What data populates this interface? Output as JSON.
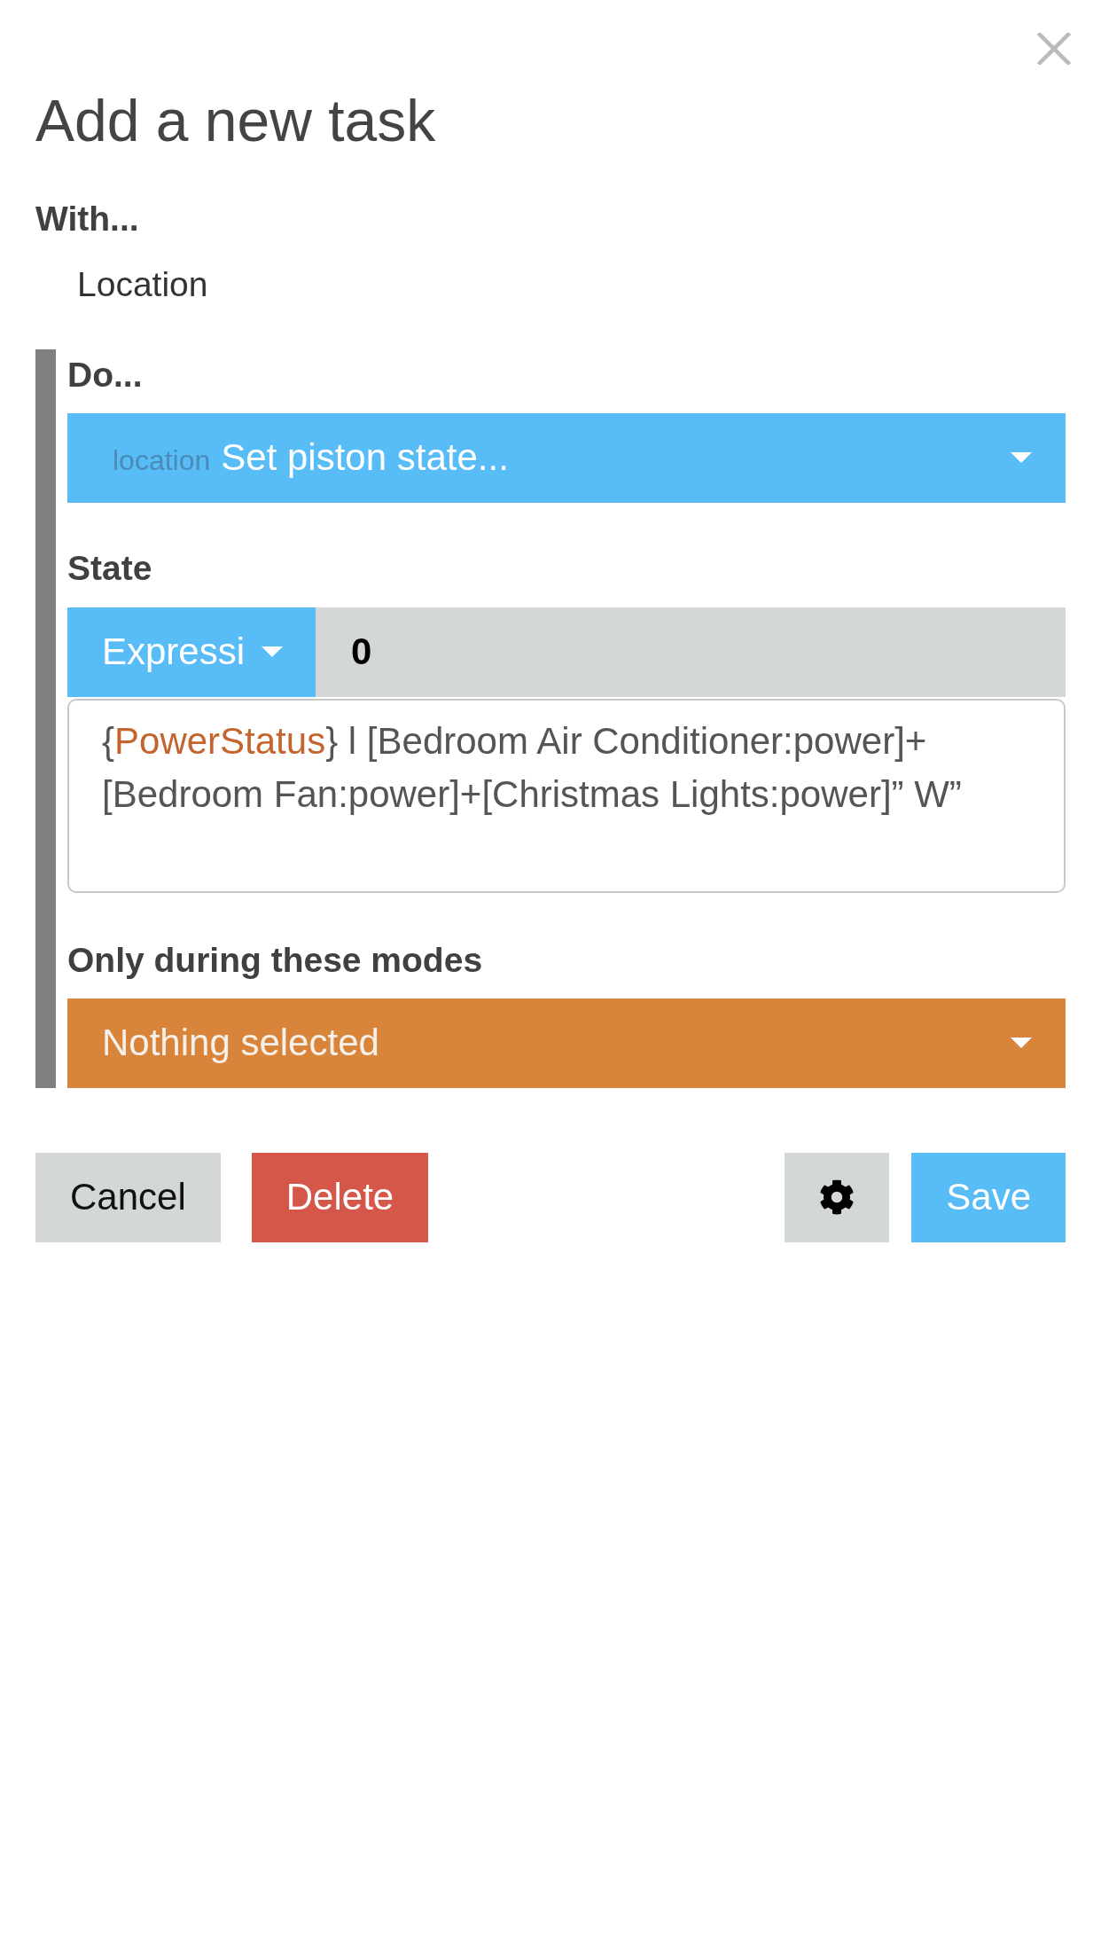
{
  "title": "Add a new task",
  "with": {
    "label": "With...",
    "value": "Location"
  },
  "do": {
    "label": "Do...",
    "context": "location",
    "value": "Set piston state..."
  },
  "state": {
    "label": "State",
    "type": "Expressi",
    "value": "0",
    "expression": [
      {
        "kind": "text",
        "text": "{"
      },
      {
        "kind": "variable",
        "text": "PowerStatus"
      },
      {
        "kind": "text",
        "text": "} l [Bedroom Air Conditioner:power]+[Bedroom Fan:power]+[Christmas Lights:power]” W”"
      }
    ]
  },
  "modes": {
    "label": "Only during these modes",
    "value": "Nothing selected"
  },
  "footer": {
    "left": [
      {
        "kind": "default",
        "label": "Cancel"
      },
      {
        "kind": "danger",
        "label": "Delete"
      }
    ],
    "right": [
      {
        "kind": "settings"
      },
      {
        "kind": "primary",
        "label": "Save"
      }
    ]
  }
}
